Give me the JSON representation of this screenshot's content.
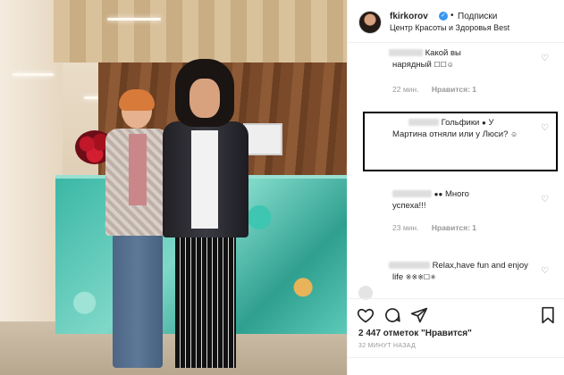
{
  "post": {
    "username": "fkirkorov",
    "follow_label": "Подписки",
    "location": "Центр Красоты и Здоровья Best"
  },
  "comments": [
    {
      "text": "Какой вы нарядный",
      "time": "",
      "likes": ""
    },
    {
      "text": "",
      "time": "22 мин.",
      "likes": "Нравится: 1"
    },
    {
      "text": "Гольфики У Мартина отняли или у Люси?",
      "time": "",
      "likes": ""
    },
    {
      "text": "Много успеха!!!",
      "time": "23 мин.",
      "likes": "Нравится: 1"
    },
    {
      "text": "Relax,have fun and enjoy life",
      "time": "",
      "likes": ""
    }
  ],
  "comment_texts": {
    "c1a": "Какой вы",
    "c1b": "нарядный",
    "c2a": "Гольфики",
    "c2b": "У",
    "c2c": "Мартина отняли или у Люси?",
    "c3a": "Много",
    "c3b": "успеха!!!",
    "c4a": "Relax,have fun and enjoy",
    "c4b": "life"
  },
  "meta": {
    "m1_time": "22 мин.",
    "m1_likes": "Нравится: 1",
    "m2_time": "23 мин.",
    "m2_likes": "Нравится: 1"
  },
  "footer": {
    "likes": "2 447 отметок \"Нравится\"",
    "timestamp": "32 МИНУТ НАЗАД"
  },
  "icons": [
    "heart-icon",
    "comment-icon",
    "share-icon",
    "bookmark-icon",
    "verified-icon"
  ]
}
